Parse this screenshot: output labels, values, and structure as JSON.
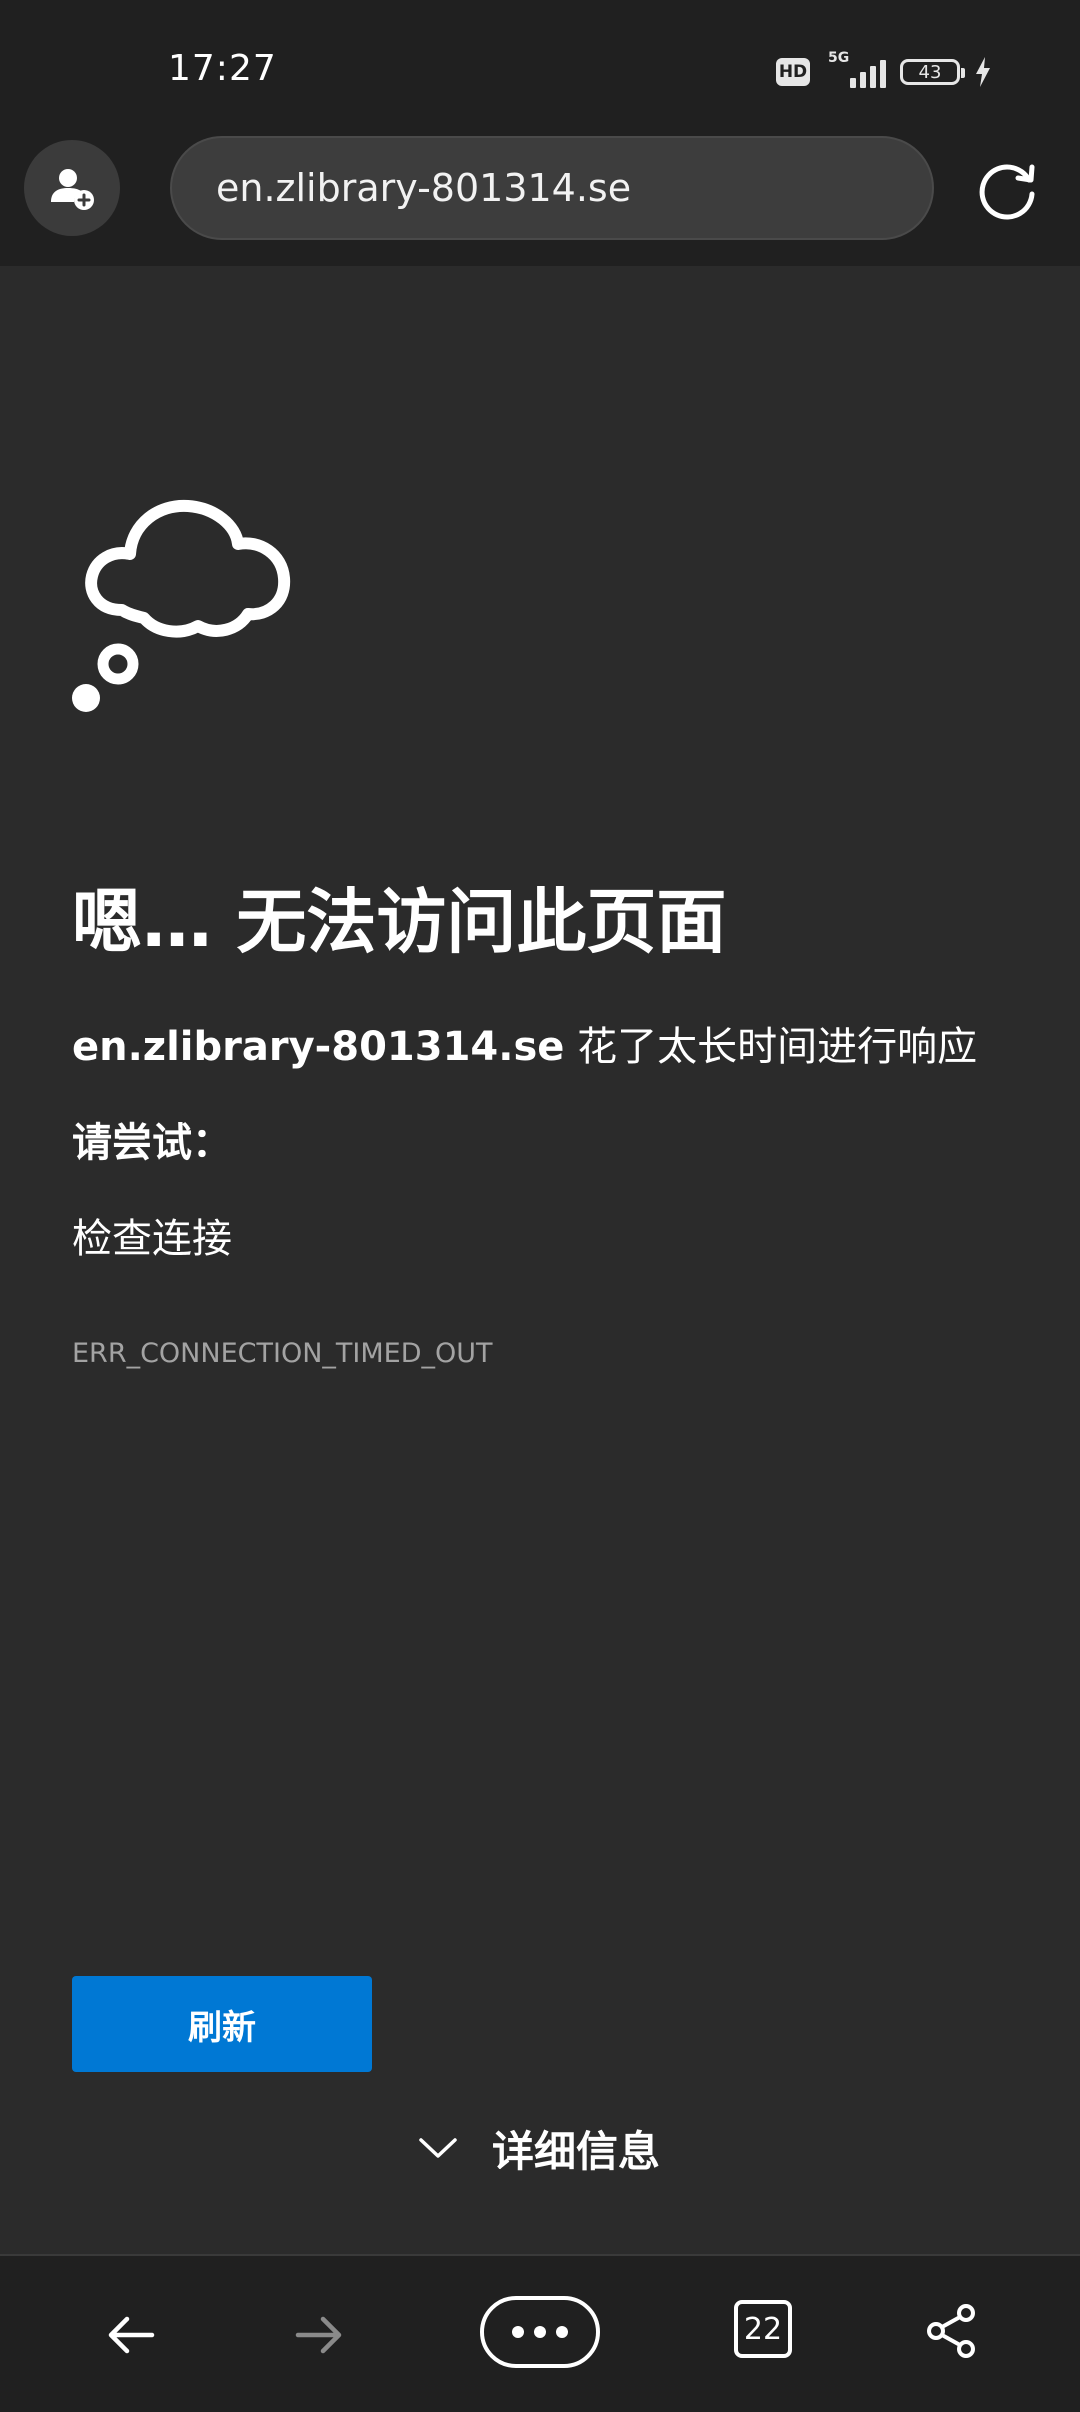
{
  "status_bar": {
    "time": "17:27",
    "hd": "HD",
    "network": "5G",
    "battery": "43",
    "icons": [
      "hd-badge",
      "signal-icon",
      "battery-icon",
      "charging-icon"
    ]
  },
  "toolbar": {
    "profile_icon": "add-profile-icon",
    "address": "en.zlibrary-801314.se",
    "refresh_icon": "refresh-icon"
  },
  "error_page": {
    "illustration": "cloud-icon",
    "title": "嗯… 无法访问此页面",
    "host": "en.zlibrary-801314.se",
    "message": " 花了太长时间进行响应",
    "try_label": "请尝试：",
    "suggestion": "检查连接",
    "error_code": "ERR_CONNECTION_TIMED_OUT",
    "reload_label": "刷新",
    "details_label": "详细信息"
  },
  "bottom_nav": {
    "tab_count": "22",
    "icons": [
      "back-arrow-icon",
      "forward-arrow-icon",
      "more-icon",
      "tabs-icon",
      "share-icon"
    ]
  },
  "colors": {
    "background": "#2b2b2b",
    "bar": "#202020",
    "accent": "#0078d4",
    "muted_text": "#a3a3a3"
  }
}
